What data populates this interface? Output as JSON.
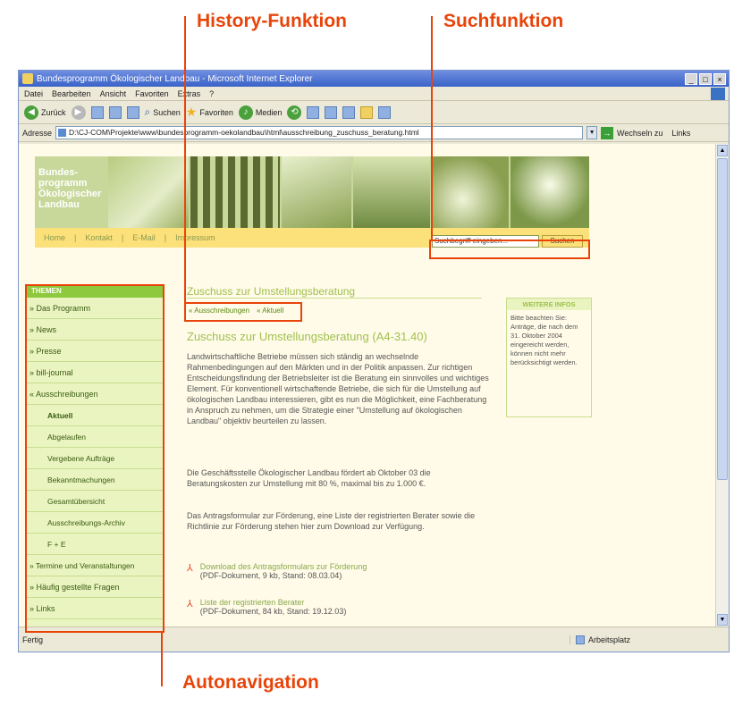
{
  "callouts": {
    "history": "History-Funktion",
    "search": "Suchfunktion",
    "autonav": "Autonavigation"
  },
  "browser": {
    "title": "Bundesprogramm Ökologischer Landbau - Microsoft Internet Explorer",
    "menu": [
      "Datei",
      "Bearbeiten",
      "Ansicht",
      "Favoriten",
      "Extras",
      "?"
    ],
    "toolbar": {
      "back": "Zurück",
      "search": "Suchen",
      "favorites": "Favoriten",
      "media": "Medien"
    },
    "address_label": "Adresse",
    "address_value": "D:\\CJ-COM\\Projekte\\www\\bundesprogramm-oekolandbau\\html\\ausschreibung_zuschuss_beratung.html",
    "go_label": "Wechseln zu",
    "links_label": "Links",
    "status_text": "Fertig",
    "zone_text": "Arbeitsplatz"
  },
  "site": {
    "logo_lines": [
      "Bundes-",
      "programm",
      "Ökologischer",
      "Landbau"
    ],
    "topnav": [
      "Home",
      "|",
      "Kontakt",
      "|",
      "E-Mail",
      "|",
      "Impressum"
    ],
    "search_placeholder": "Suchbegriff eingeben...",
    "search_button": "Suchen",
    "leftnav_head": "THEMEN",
    "leftnav_items": [
      {
        "label": "» Das Programm",
        "type": "item"
      },
      {
        "label": "» News",
        "type": "item"
      },
      {
        "label": "» Presse",
        "type": "item"
      },
      {
        "label": "» bill-journal",
        "type": "item"
      },
      {
        "label": "« Ausschreibungen",
        "type": "item"
      },
      {
        "label": "Aktuell",
        "type": "sub-active"
      },
      {
        "label": "Abgelaufen",
        "type": "sub"
      },
      {
        "label": "Vergebene Aufträge",
        "type": "sub"
      },
      {
        "label": "Bekanntmachungen",
        "type": "sub"
      },
      {
        "label": "Gesamtübersicht",
        "type": "sub"
      },
      {
        "label": "Ausschreibungs-Archiv",
        "type": "sub"
      },
      {
        "label": "F + E",
        "type": "sub"
      },
      {
        "label": "» Termine und Veranstaltungen",
        "type": "item"
      },
      {
        "label": "» Häufig gestellte Fragen",
        "type": "item"
      },
      {
        "label": "» Links",
        "type": "item"
      }
    ],
    "content_title": "Zuschuss zur Umstellungsberatung",
    "breadcrumb": [
      "« Ausschreibungen",
      "« Aktuell"
    ],
    "content_heading": "Zuschuss zur Umstellungsberatung (A4-31.40)",
    "paragraphs": [
      "Landwirtschaftliche Betriebe müssen sich ständig an wechselnde Rahmenbedingungen auf den Märkten und in der Politik anpassen. Zur richtigen Entscheidungsfindung der Betriebsleiter ist die Beratung ein sinnvolles und wichtiges Element. Für konventionell wirtschaftende Betriebe, die sich für die Umstellung auf ökologischen Landbau interessieren, gibt es nun die Möglichkeit, eine Fachberatung in Anspruch zu nehmen, um die Strategie einer \"Umstellung auf ökologischen Landbau\" objektiv beurteilen zu lassen.",
      "Die Geschäftsstelle Ökologischer Landbau fördert ab Oktober 03 die Beratungskosten zur Umstellung mit 80 %, maximal bis zu 1.000 €.",
      "Das Antragsformular zur Förderung, eine Liste der registrierten Berater sowie die Richtlinie zur Förderung stehen hier zum Download zur Verfügung."
    ],
    "downloads": [
      {
        "title": "Download des Antragsformulars zur Förderung",
        "meta": "(PDF-Dokument, 9 kb, Stand: 08.03.04)"
      },
      {
        "title": "Liste der registrierten Berater",
        "meta": "(PDF-Dokument, 84 kb, Stand: 19.12.03)"
      }
    ],
    "infobox_head": "WEITERE INFOS",
    "infobox_text": "Bitte beachten Sie: Anträge, die nach dem 31. Oktober 2004 eingereicht werden, können nicht mehr berücksichtigt werden."
  },
  "colors": {
    "accent": "#e8440a",
    "site_green": "#8ec83c",
    "nav_bg": "#e9f4c0"
  }
}
